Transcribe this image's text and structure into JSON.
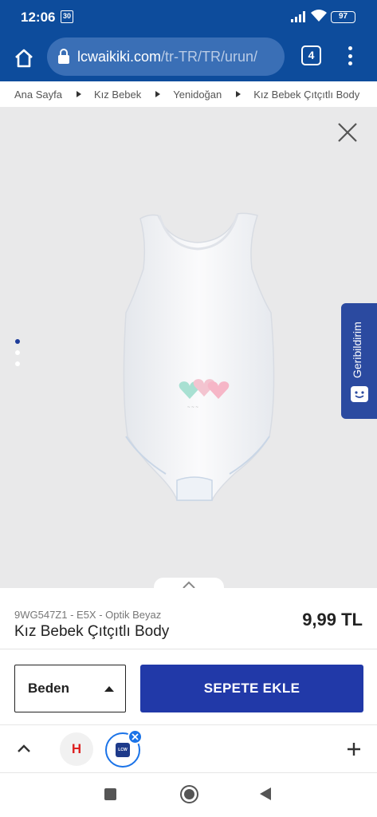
{
  "status_bar": {
    "time": "12:06",
    "notification_badge": "30",
    "battery": "97",
    "icons": [
      "notification-icon",
      "signal-icon",
      "wifi-icon",
      "battery-icon"
    ]
  },
  "browser": {
    "url_domain": "lcwaikiki.com",
    "url_path": "/tr-TR/TR/urun/",
    "tab_count": "4",
    "icons": [
      "home-icon",
      "lock-icon",
      "tabs-icon",
      "menu-icon"
    ]
  },
  "breadcrumb": {
    "items": [
      "Ana Sayfa",
      "Kız Bebek",
      "Yenidoğan",
      "Kız Bebek Çıtçıtlı Body"
    ]
  },
  "gallery": {
    "dot_count": 3,
    "active_dot": 0,
    "feedback_label": "Geribildirim",
    "icons": [
      "close-icon",
      "feedback-face-icon",
      "chevron-up-icon"
    ]
  },
  "product": {
    "code": "9WG547Z1 - E5X - Optik Beyaz",
    "name": "Kız Bebek Çıtçıtlı Body",
    "price": "9,99 TL"
  },
  "actions": {
    "size_label": "Beden",
    "add_to_cart_label": "SEPETE EKLE"
  },
  "tab_strip": {
    "tab_h_letter": "H",
    "tab_lcw_logo": "LCW",
    "icons": [
      "chevron-up-icon",
      "close-icon",
      "plus-icon"
    ]
  },
  "colors": {
    "brand_blue": "#0d4c9c",
    "cart_button": "#2139a8",
    "feedback_tab": "#2b4aa0",
    "gallery_bg": "#e9e9ea"
  }
}
